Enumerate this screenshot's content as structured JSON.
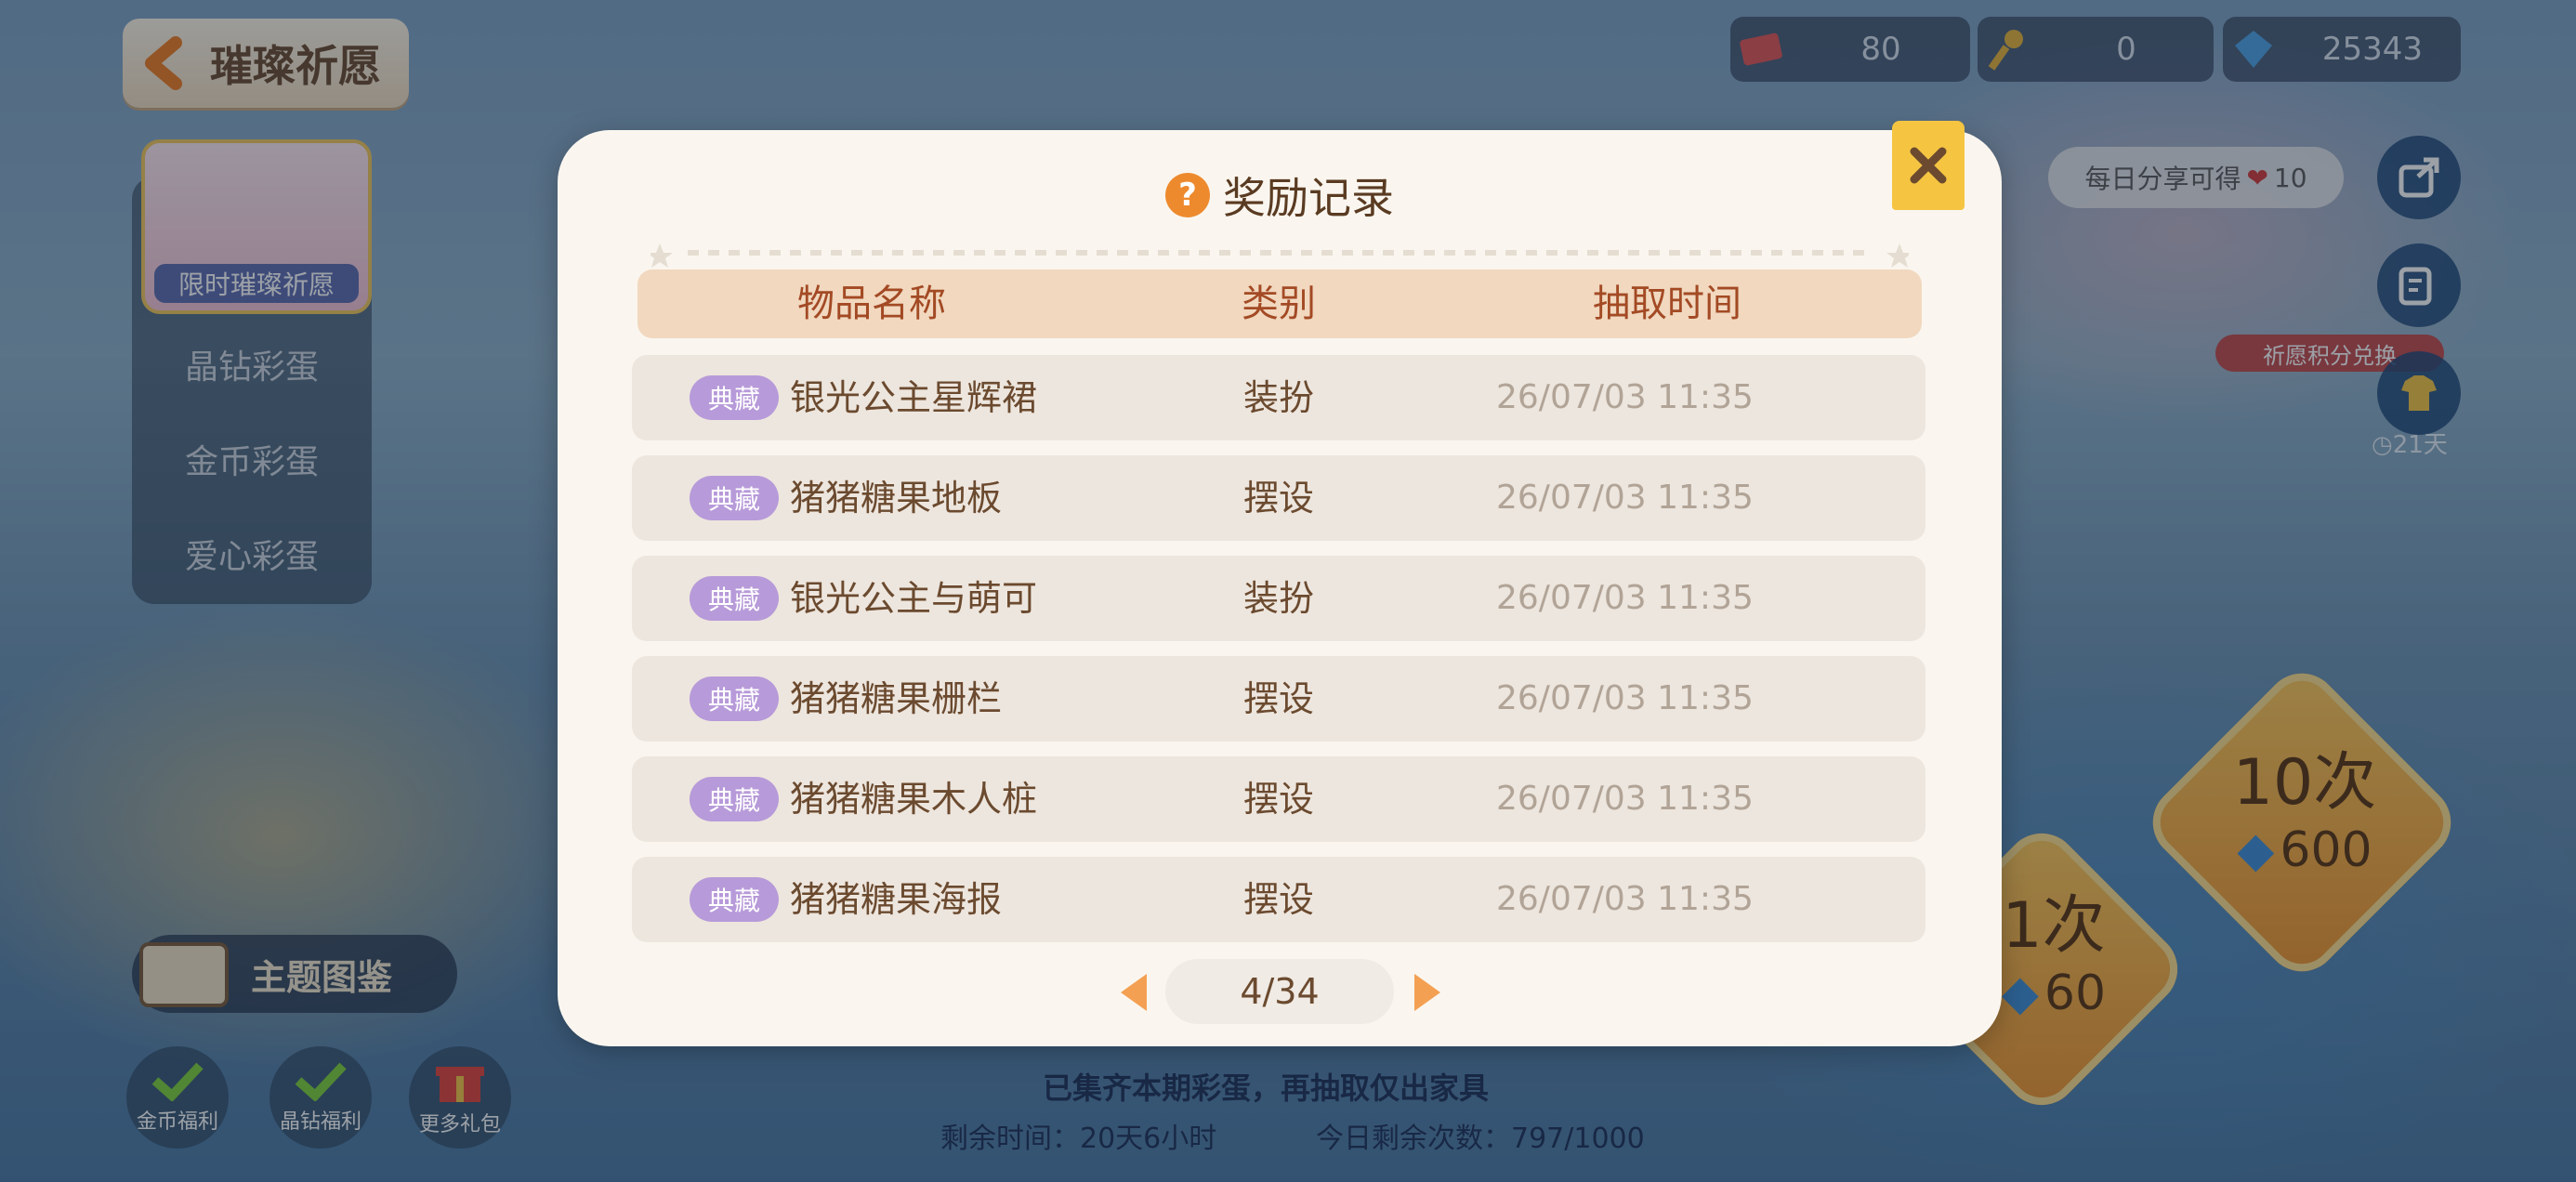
{
  "header": {
    "title": "璀璨祈愿"
  },
  "side_menu": {
    "banner_label": "限时璀璨祈愿",
    "items": [
      "晶钻彩蛋",
      "金币彩蛋",
      "爱心彩蛋"
    ]
  },
  "resources": [
    {
      "icon": "ticket-icon",
      "value": "80"
    },
    {
      "icon": "key-icon",
      "value": "0"
    },
    {
      "icon": "gem-icon",
      "value": "25343"
    }
  ],
  "share": {
    "text": "每日分享可得",
    "amount": "10"
  },
  "exchange_tag": "祈愿积分兑换",
  "days_left": "21天",
  "draw": {
    "ten": {
      "label": "10次",
      "cost": "600"
    },
    "one": {
      "label": "1次",
      "cost": "60"
    }
  },
  "bottom": {
    "theme_label": "主题图鉴",
    "mini_buttons": [
      "金币福利",
      "晶钻福利",
      "更多礼包"
    ],
    "message": "已集齐本期彩蛋，再抽取仅出家具",
    "remaining_time": "剩余时间：20天6小时",
    "remaining_count": "今日剩余次数：797/1000"
  },
  "modal": {
    "title": "奖励记录",
    "columns": [
      "物品名称",
      "类别",
      "抽取时间"
    ],
    "rows": [
      {
        "badge": "典藏",
        "name": "银光公主星辉裙",
        "category": "装扮",
        "time": "26/07/03  11:35"
      },
      {
        "badge": "典藏",
        "name": "猪猪糖果地板",
        "category": "摆设",
        "time": "26/07/03  11:35"
      },
      {
        "badge": "典藏",
        "name": "银光公主与萌可",
        "category": "装扮",
        "time": "26/07/03  11:35"
      },
      {
        "badge": "典藏",
        "name": "猪猪糖果栅栏",
        "category": "摆设",
        "time": "26/07/03  11:35"
      },
      {
        "badge": "典藏",
        "name": "猪猪糖果木人桩",
        "category": "摆设",
        "time": "26/07/03  11:35"
      },
      {
        "badge": "典藏",
        "name": "猪猪糖果海报",
        "category": "摆设",
        "time": "26/07/03  11:35"
      }
    ],
    "pager": "4/34"
  },
  "colors": {
    "accent": "#ee8a2e",
    "badge": "#b79ad9",
    "header_text": "#a34a24",
    "close": "#f5c542"
  }
}
